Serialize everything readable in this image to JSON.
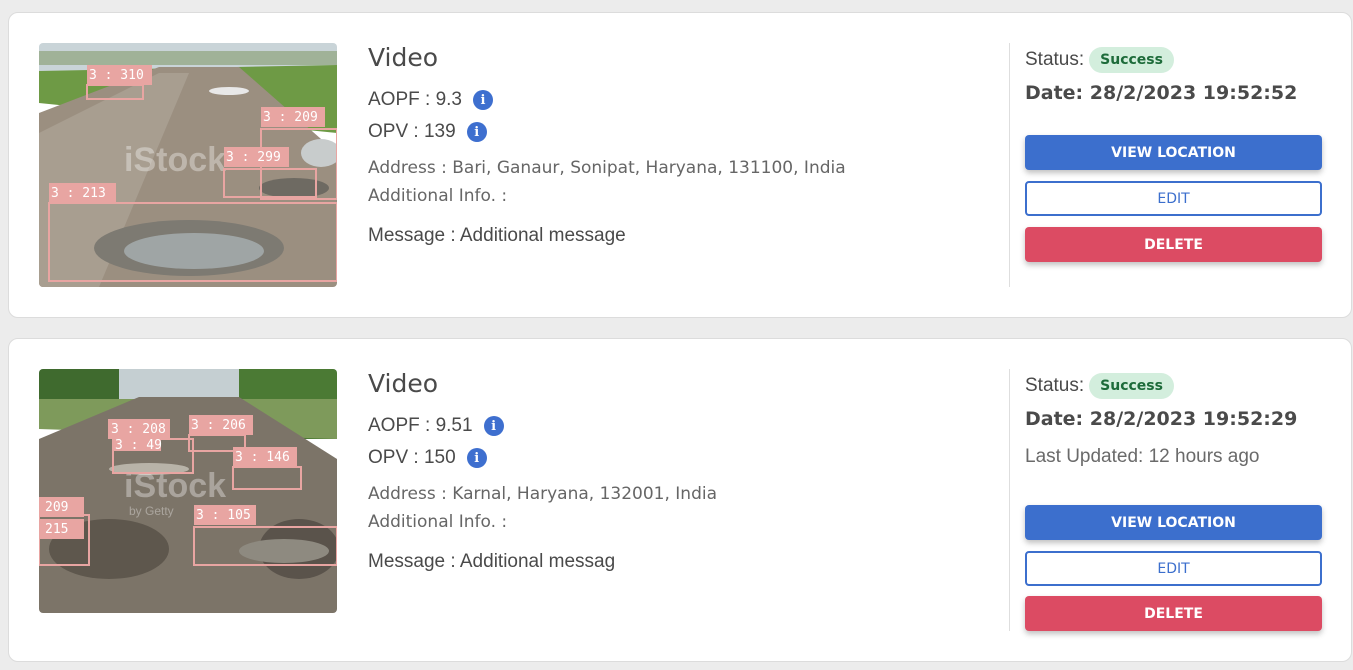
{
  "records": [
    {
      "type_label": "Video",
      "aopf": "AOPF : 9.3",
      "opv": "OPV : 139",
      "address": "Address : Bari, Ganaur, Sonipat, Haryana, 131100, India",
      "additional_info": "Additional Info. :",
      "message": "Message : Additional message",
      "status_label": "Status:",
      "status_value": "Success",
      "date": "Date: 28/2/2023 19:52:52",
      "last_updated": "",
      "buttons": {
        "view": "VIEW LOCATION",
        "edit": "EDIT",
        "delete": "DELETE"
      },
      "thumbnail": {
        "watermark": "iStock",
        "detections": [
          "3 : 310",
          "3 : 209",
          "3 : 299",
          "3 : 213"
        ]
      }
    },
    {
      "type_label": "Video",
      "aopf": "AOPF : 9.51",
      "opv": "OPV : 150",
      "address": "Address : Karnal, Haryana, 132001, India",
      "additional_info": "Additional Info. :",
      "message": "Message : Additional messag",
      "status_label": "Status:",
      "status_value": "Success",
      "date": "Date: 28/2/2023 19:52:29",
      "last_updated": "Last Updated: 12 hours ago",
      "buttons": {
        "view": "VIEW LOCATION",
        "edit": "EDIT",
        "delete": "DELETE"
      },
      "thumbnail": {
        "watermark": "iStock",
        "watermark_sub": "by Getty",
        "detections": [
          "3 : 208",
          "3 : 49",
          "3 : 206",
          "3 : 146",
          "209",
          "215",
          "3 : 105"
        ]
      }
    }
  ],
  "colors": {
    "primary": "#3c6fcd",
    "danger": "#dc4b63",
    "success_bg": "#d3eedd",
    "success_text": "#1d6b3a",
    "info_icon": "#3e6fcf"
  },
  "icons": {
    "info": "info-icon"
  }
}
